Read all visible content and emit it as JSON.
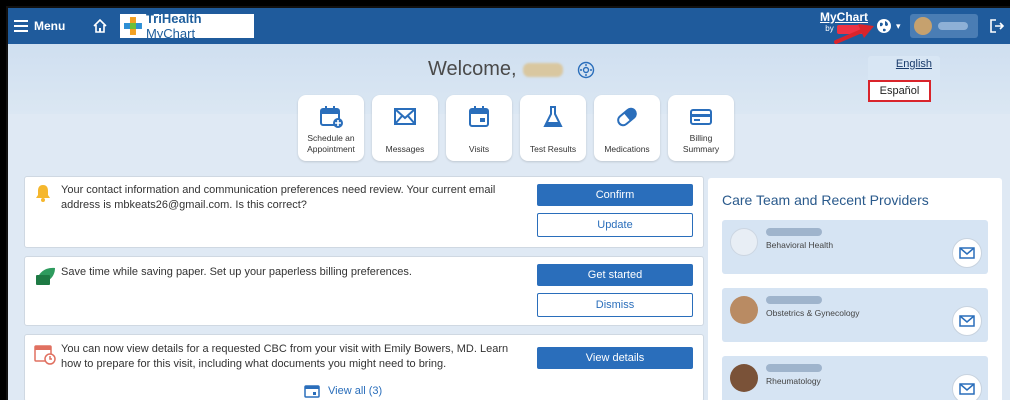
{
  "header": {
    "menu_label": "Menu",
    "logo_bold": "TriHealth",
    "logo_light": " MyChart",
    "brand_top": "MyChart",
    "brand_by": "by"
  },
  "welcome": {
    "text": "Welcome,"
  },
  "tiles": [
    {
      "line1": "Schedule an",
      "line2": "Appointment"
    },
    {
      "line1": "",
      "line2": "Messages"
    },
    {
      "line1": "",
      "line2": "Visits"
    },
    {
      "line1": "",
      "line2": "Test Results"
    },
    {
      "line1": "",
      "line2": "Medications"
    },
    {
      "line1": "Billing",
      "line2": "Summary"
    }
  ],
  "language_menu": {
    "english": "English",
    "spanish": "Español"
  },
  "alerts": {
    "contact": {
      "line1": "Your contact information and communication preferences need review. Your current email",
      "line2": "address is mbkeats26@gmail.com. Is this correct?",
      "primary": "Confirm",
      "secondary": "Update"
    },
    "paperless": {
      "line1": "Save time while saving paper. Set up your paperless billing preferences.",
      "primary": "Get started",
      "secondary": "Dismiss"
    },
    "cbc": {
      "line1": "You can now view details for a requested CBC from your visit with Emily Bowers, MD. Learn",
      "line2": "how to prepare for this visit, including what documents you might need to bring.",
      "primary": "View details"
    },
    "view_all": "View all (3)"
  },
  "care_team": {
    "title": "Care Team and Recent Providers",
    "providers": [
      {
        "specialty": "Behavioral Health"
      },
      {
        "specialty": "Obstetrics & Gynecology"
      },
      {
        "specialty": "Rheumatology"
      }
    ]
  },
  "colors": {
    "header": "#1f5b9c",
    "primary_button": "#2a6ebb",
    "highlight": "#d9242b"
  }
}
